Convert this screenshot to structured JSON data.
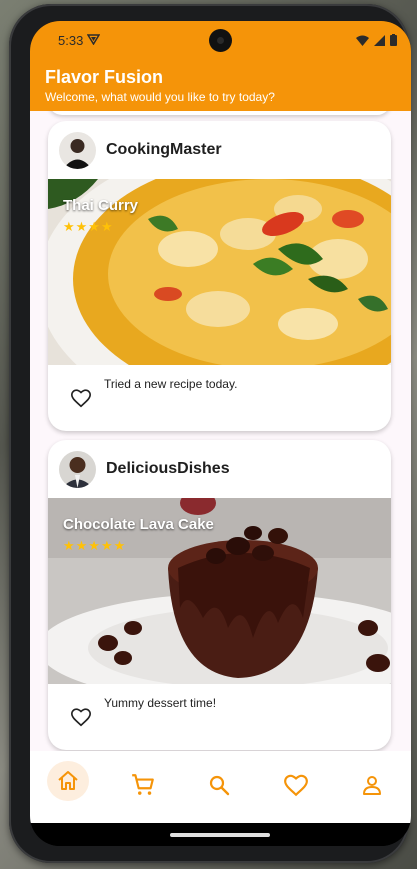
{
  "status_bar": {
    "time": "5:33"
  },
  "header": {
    "title": "Flavor Fusion",
    "subtitle": "Welcome, what would you like to try today?"
  },
  "posts": [
    {
      "username": "CookingMaster",
      "dish": "Thai Curry",
      "rating": "★★★★",
      "caption": "Tried a new recipe today."
    },
    {
      "username": "DeliciousDishes",
      "dish": "Chocolate Lava Cake",
      "rating": "★★★★★",
      "caption": "Yummy dessert time!"
    }
  ],
  "bottom_nav": {
    "items": [
      "home-icon",
      "cart-icon",
      "search-icon",
      "heart-icon",
      "person-icon"
    ],
    "active": "home-icon"
  },
  "colors": {
    "accent": "#F59409",
    "star": "#FFC107",
    "background": "#FDF7FB"
  }
}
